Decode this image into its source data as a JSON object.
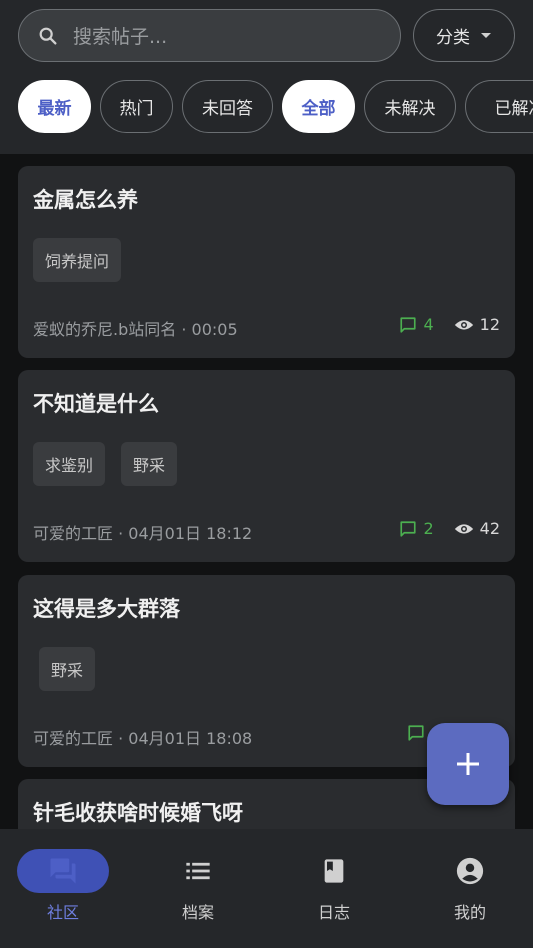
{
  "search": {
    "placeholder": "搜索帖子..."
  },
  "category_button": {
    "label": "分类"
  },
  "filters": [
    {
      "label": "最新",
      "selected": true
    },
    {
      "label": "热门",
      "selected": false
    },
    {
      "label": "未回答",
      "selected": false
    },
    {
      "label": "全部",
      "selected": true
    },
    {
      "label": "未解决",
      "selected": false
    },
    {
      "label": "已解决",
      "selected": false
    }
  ],
  "posts": [
    {
      "title": "金属怎么养",
      "tags": [
        "饲养提问"
      ],
      "author": "爱蚁的乔尼.b站同名",
      "time": "00:05",
      "comments": "4",
      "views": "12"
    },
    {
      "title": "不知道是什么",
      "tags": [
        "求鉴别",
        "野采"
      ],
      "author": "可爱的工匠",
      "time": "04月01日 18:12",
      "comments": "2",
      "views": "42"
    },
    {
      "title": "这得是多大群落",
      "tags": [
        "野采"
      ],
      "author": "可爱的工匠",
      "time": "04月01日 18:08",
      "comments": "",
      "views": ""
    },
    {
      "title": "针毛收获啥时候婚飞呀",
      "tags": [],
      "author": "",
      "time": "",
      "comments": "",
      "views": ""
    }
  ],
  "separator": "·",
  "fab": {
    "icon": "plus-icon"
  },
  "nav": [
    {
      "label": "社区",
      "icon": "forum-icon",
      "active": true
    },
    {
      "label": "档案",
      "icon": "list-icon",
      "active": false
    },
    {
      "label": "日志",
      "icon": "book-icon",
      "active": false
    },
    {
      "label": "我的",
      "icon": "account-icon",
      "active": false
    }
  ],
  "colors": {
    "accent": "#5c6bc0",
    "comment_green": "#4caf50",
    "background": "#111213",
    "surface": "#2a2c2f"
  }
}
